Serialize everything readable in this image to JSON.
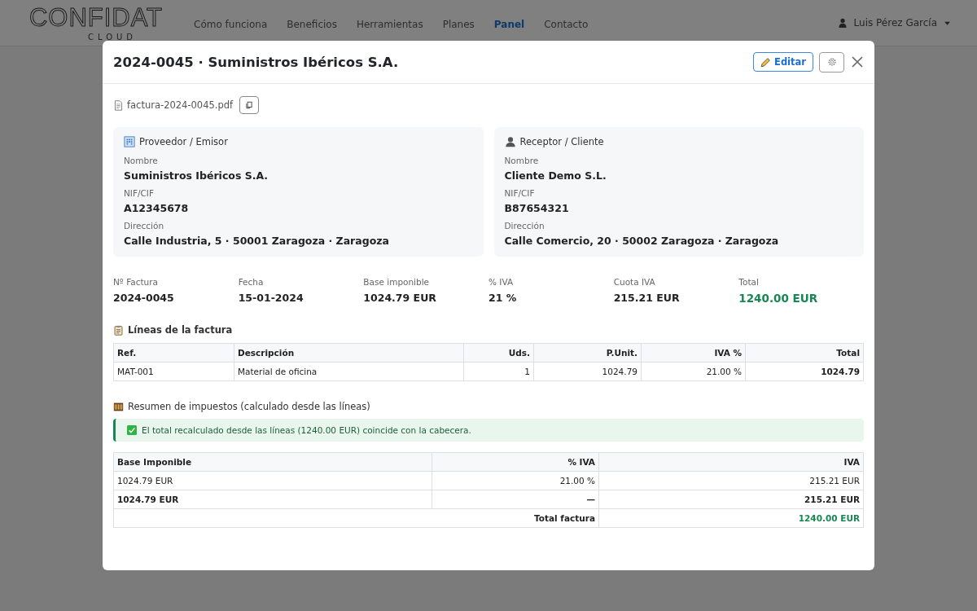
{
  "brand": {
    "name": "CONFIDAT",
    "sub": "CLOUD"
  },
  "nav": [
    {
      "label": "Cómo funciona",
      "selected": false
    },
    {
      "label": "Beneficios",
      "selected": false
    },
    {
      "label": "Herramientas",
      "selected": false
    },
    {
      "label": "Planes",
      "selected": false
    },
    {
      "label": "Panel",
      "selected": true
    },
    {
      "label": "Contacto",
      "selected": false
    }
  ],
  "user": {
    "name": "Luis Pérez García"
  },
  "modal": {
    "title": "2024-0045 · Suministros Ibéricos S.A.",
    "edit_button": "Editar",
    "file": "factura-2024-0045.pdf",
    "parties": [
      {
        "kind": "provider",
        "title": "Proveedor / Emisor",
        "fields": [
          {
            "label": "Nombre",
            "value": "Suministros Ibéricos S.A."
          },
          {
            "label": "NIF/CIF",
            "value": "A12345678"
          },
          {
            "label": "Dirección",
            "value": "Calle Industria, 5 · 50001 Zaragoza · Zaragoza"
          }
        ]
      },
      {
        "kind": "client",
        "title": "Receptor / Cliente",
        "fields": [
          {
            "label": "Nombre",
            "value": "Cliente Demo S.L."
          },
          {
            "label": "NIF/CIF",
            "value": "B87654321"
          },
          {
            "label": "Dirección",
            "value": "Calle Comercio, 20 · 50002 Zaragoza · Zaragoza"
          }
        ]
      }
    ],
    "summary": [
      {
        "label": "Nº Factura",
        "value": "2024-0045",
        "kind": "plain"
      },
      {
        "label": "Fecha",
        "value": "15-01-2024",
        "kind": "plain"
      },
      {
        "label": "Base imponible",
        "value": "1024.79 EUR",
        "kind": "plain"
      },
      {
        "label": "% IVA",
        "value": "21 %",
        "kind": "plain"
      },
      {
        "label": "Cuota IVA",
        "value": "215.21 EUR",
        "kind": "plain"
      },
      {
        "label": "Total",
        "value": "1240.00 EUR",
        "kind": "total"
      }
    ],
    "lines_title": "Líneas de la factura",
    "lines_table": {
      "columns": [
        "Ref.",
        "Descripción",
        "Uds.",
        "P.Unit.",
        "IVA %",
        "Total"
      ],
      "rows": [
        [
          "MAT-001",
          "Material de oficina",
          "1",
          "1024.79",
          "21.00 %",
          "1024.79"
        ]
      ]
    },
    "tax_title": "Resumen de impuestos (calculado desde las líneas)",
    "tax_notice": "El total recalculado desde las líneas (1240.00 EUR) coincide con la cabecera.",
    "tax_table": {
      "columns": [
        "Base Imponible",
        "% IVA",
        "IVA"
      ],
      "rows": [
        {
          "kind": "rate",
          "cells": [
            "1024.79 EUR",
            "21.00 %",
            "215.21 EUR"
          ]
        },
        {
          "kind": "subtotal",
          "cells": [
            "1024.79 EUR",
            "—",
            "215.21 EUR"
          ]
        },
        {
          "kind": "total",
          "cells": [
            {
              "text": "Total factura",
              "colspan": 2
            },
            {
              "text": "1240.00 EUR"
            }
          ]
        }
      ]
    }
  }
}
